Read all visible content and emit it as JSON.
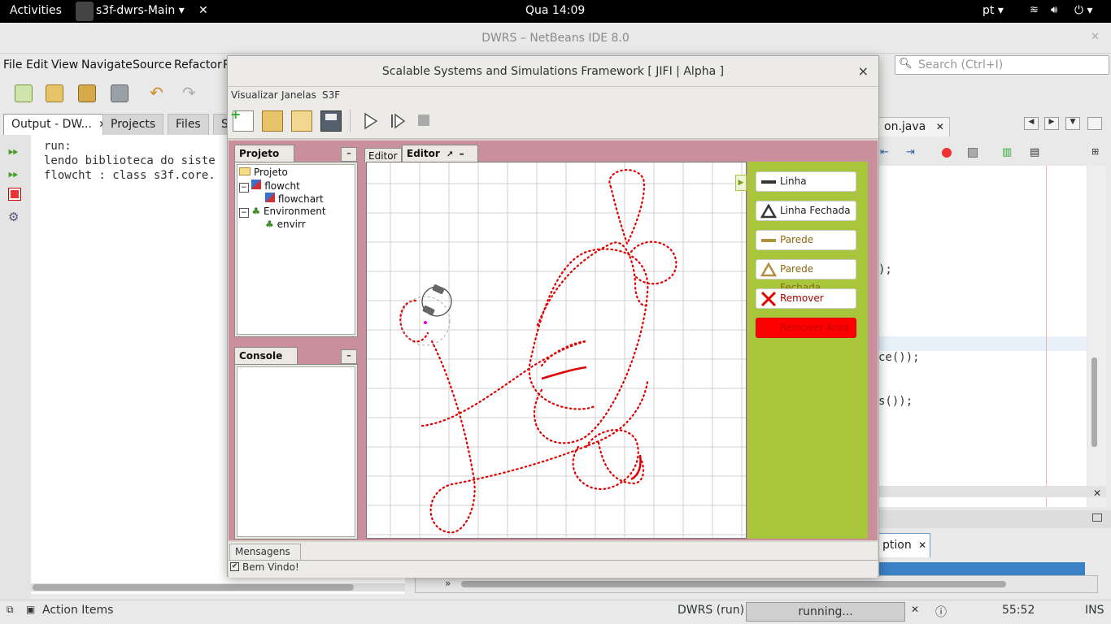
{
  "topbar": {
    "activities": "Activities",
    "app_menu": "s3f-dwrs-Main ▾",
    "close_symbol": "✕",
    "clock": "Qua 14:09",
    "lang": "pt ▾",
    "power": "⏻ ▾"
  },
  "ide": {
    "title": "DWRS – NetBeans IDE 8.0",
    "menu": [
      "File",
      "Edit",
      "View",
      "Navigate",
      "Source",
      "Refactor",
      "R"
    ],
    "search_placeholder": "Search (Ctrl+I)",
    "left_tabs": [
      "Output - DW...",
      "Projects",
      "Files",
      "S"
    ],
    "close_symbol": "✕",
    "output_lines": [
      "run:",
      "lendo biblioteca do siste",
      "flowcht : class s3f.core."
    ],
    "editor_tab": "on.java",
    "code_lines": [
      ");",
      "ce());",
      "s());"
    ],
    "bottom_tab": "ption",
    "chevron": "»",
    "status": {
      "action_items": "Action Items",
      "run_label": "DWRS (run)",
      "progress_text": "running...",
      "position": "55:52",
      "mode": "INS"
    }
  },
  "dialog": {
    "title": "Scalable Systems and Simulations Framework [ JIFI | Alpha ]",
    "close_symbol": "×",
    "menu": [
      "Visualizar",
      "Janelas",
      "S3F"
    ],
    "project_panel": {
      "tab": "Projeto",
      "minimize": "–",
      "tree": [
        "Projeto",
        "flowcht",
        "flowchart",
        "Environment",
        "envirr"
      ]
    },
    "console_panel": {
      "tab": "Console",
      "minimize": "–"
    },
    "editor_tabs": {
      "inactive": "Editor",
      "active": "Editor",
      "pin": "↗",
      "minimize": "–",
      "close": "✕"
    },
    "tools": [
      {
        "label": "Linha",
        "color": "#333333"
      },
      {
        "label": "Linha Fechada",
        "color": "#333333"
      },
      {
        "label": "Parede",
        "color": "#8b6914"
      },
      {
        "label": "Parede Fechada",
        "color": "#8b6914"
      },
      {
        "label": "Remover",
        "color": "#cc0000"
      },
      {
        "label": "Remover Area",
        "color": "#cc0000"
      }
    ],
    "messages_tab": "Mensagens",
    "welcome": "Bem Vindo!",
    "welcome_checked": true
  },
  "colors": {
    "accent_green": "#a8c63c",
    "panel_bg": "#c98f9d",
    "trail": "#e00000"
  }
}
